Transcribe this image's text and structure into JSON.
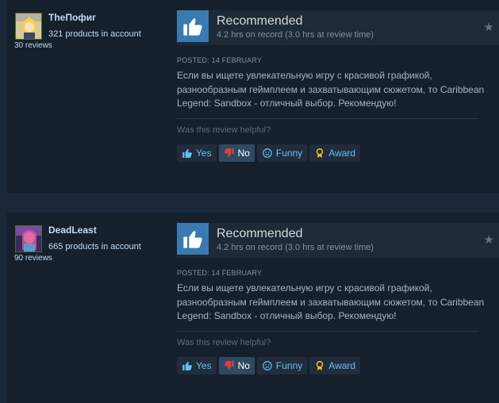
{
  "reviews": [
    {
      "username": "TheПофиг",
      "products": "321 products in account",
      "review_count": "30 reviews",
      "recommendation": "Recommended",
      "hours": "4.2 hrs on record (3.0 hrs at review time)",
      "posted": "POSTED: 14 FEBRUARY",
      "text": "Если вы ищете увлекательную игру с красивой графикой, разнообразным геймплеем и захватывающим сюжетом, то Caribbean Legend: Sandbox - отличный выбор. Рекомендую!",
      "helpful_prompt": "Was this review helpful?",
      "buttons": {
        "yes": "Yes",
        "no": "No",
        "funny": "Funny",
        "award": "Award"
      }
    },
    {
      "username": "DeadLeast",
      "products": "665 products in account",
      "review_count": "90 reviews",
      "recommendation": "Recommended",
      "hours": "4.2 hrs on record (3.0 hrs at review time)",
      "posted": "POSTED: 14 FEBRUARY",
      "text": "Если вы ищете увлекательную игру с красивой графикой, разнообразным геймплеем и захватывающим сюжетом, то Caribbean Legend: Sandbox - отличный выбор. Рекомендую!",
      "helpful_prompt": "Was this review helpful?",
      "buttons": {
        "yes": "Yes",
        "no": "No",
        "funny": "Funny",
        "award": "Award"
      }
    }
  ],
  "colors": {
    "background": "#1b2838",
    "card": "#16202d",
    "thumb_box": "#3a7ab3",
    "link": "#66c0f4",
    "no_active": "#2e4a62"
  },
  "icons": [
    "avatar",
    "thumbs-up-icon",
    "star-icon",
    "thumbs-up-small-icon",
    "thumbs-down-icon",
    "smiley-icon",
    "award-icon"
  ]
}
